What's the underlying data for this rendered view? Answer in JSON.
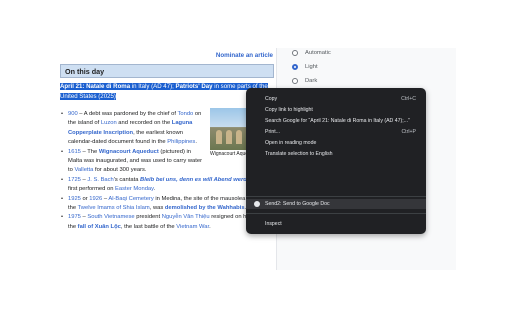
{
  "article": {
    "nominate_link": "Nominate an article",
    "section_title": "On this day",
    "headline": {
      "date_label": "April 21",
      "event1": "Natale di Roma",
      "event1_rest": " in Italy (AD 47); ",
      "event2": "Patriots' Day",
      "event2_rest": " in some parts of the United States (2025)"
    },
    "items": [
      {
        "year": "900",
        "text": " – A debt was pardoned by the chief of ",
        "l1": "Tondo",
        "t2": " on the island of ",
        "l2": "Luzon",
        "t3": " and recorded on the ",
        "bold": "Laguna Copperplate Inscription",
        "t4": ", the earliest known calendar-dated document found in the ",
        "l3": "Philippines",
        "t5": "."
      },
      {
        "year": "1615",
        "text": " – The ",
        "bold": "Wignacourt Aqueduct",
        "t2": " (pictured) in Malta was inaugurated, and was used to carry water to ",
        "l1": "Valletta",
        "t3": " for about 300 years."
      },
      {
        "year": "1725",
        "text": " – ",
        "l1": "J. S. Bach",
        "t2": "'s cantata ",
        "bold": "Bleib bei uns, denn es will Abend werden",
        "t3": ", was first performed on ",
        "l2": "Easter Monday",
        "t4": "."
      },
      {
        "year": "1925",
        "text": " or ",
        "year2": "1926",
        "t2": " – ",
        "l1": "Al-Baqi Cemetery",
        "t3": " in Medina, the site of the mausolea of four of the ",
        "l2": "Twelve Imams of Shia Islam",
        "t4": ", was ",
        "bold": "demolished by the Wahhabis",
        "t5": "."
      },
      {
        "year": "1975",
        "text": " – ",
        "l1": "South Vietnamese",
        "t2": " president ",
        "l2": "Nguyễn Văn Thiệu",
        "t3": " resigned on hearing of the ",
        "bold": "fall of Xuân Lộc",
        "t4": ", the last battle of the ",
        "l3": "Vietnam War",
        "t5": "."
      }
    ],
    "image_caption": "Wignacourt Aqueduct"
  },
  "appearance": {
    "options": [
      "Automatic",
      "Light",
      "Dark"
    ],
    "selected": "Light"
  },
  "context_menu": {
    "items": [
      {
        "label": "Copy",
        "shortcut": "Ctrl+C"
      },
      {
        "label": "Copy link to highlight",
        "shortcut": ""
      },
      {
        "label": "Search Google for “April 21: Natale di Roma in Italy (AD 47);...”",
        "shortcut": ""
      },
      {
        "label": "Print...",
        "shortcut": "Ctrl+P"
      },
      {
        "label": "Open in reading mode",
        "shortcut": ""
      },
      {
        "label": "Translate selection to English",
        "shortcut": ""
      }
    ],
    "extension_item": "Send2: Send to Google Doc",
    "inspect": "Inspect"
  }
}
